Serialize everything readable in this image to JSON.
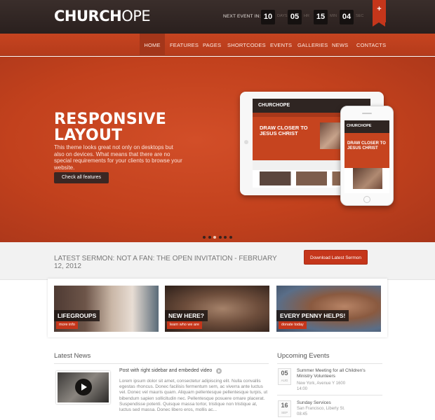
{
  "header": {
    "logo_bold": "CHURCH",
    "logo_light": "OPE",
    "next_event_label": "NEXT EVENT IN:",
    "countdown": [
      {
        "value": "10",
        "unit": "DAYS"
      },
      {
        "value": "05",
        "unit": "HR"
      },
      {
        "value": "15",
        "unit": "MIN"
      },
      {
        "value": "04",
        "unit": "SEC"
      }
    ],
    "ribbon_label": "+"
  },
  "nav": {
    "items": [
      "HOME",
      "FEATURES",
      "PAGES",
      "SHORTCODES",
      "EVENTS",
      "GALLERIES",
      "NEWS",
      "CONTACTS"
    ],
    "active": "HOME"
  },
  "hero": {
    "title_line1": "RESPONSIVE",
    "title_line2": "LAYOUT",
    "text": "This theme looks great not only on desktops but also on devices. What means that there are no special requirements  for your clients to browse your website.",
    "button": "Check all features",
    "mockup_logo": "CHURCHOPE",
    "mockup_heading_line1": "DRAW CLOSER TO",
    "mockup_heading_line2": "JESUS CHRIST",
    "slide_count": 6,
    "active_slide": 3
  },
  "sermon": {
    "text": "LATEST SERMON: NOT A FAN: THE OPEN INVITATION - FEBRUARY 12, 2012",
    "button": "Download Latest Sermon"
  },
  "cards": [
    {
      "title": "LIFEGROUPS",
      "tag": "more info"
    },
    {
      "title": "NEW HERE?",
      "tag": "learn who we are"
    },
    {
      "title": "EVERY PENNY HELPS!",
      "tag": "donate today"
    }
  ],
  "news": {
    "heading": "Latest News",
    "post_title": "Post with right sidebar and embeded video",
    "post_body": "Lorem ipsum dolor sit amet, consectetur adipiscing elit. Nulla convallis egestas rhoncus. Donec facilisis fermentum sem, ac viverra ante luctus vel. Donec vel mauris quam. Aliquam pellentesque pellentesque turpis, ut bibendum sapien sollicitudin nec. Pellentesque posuere ornare placerat. Suspendisse potenti. Quisque massa tortor, tristique non tristique at, luctus sed massa. Donec libero eros, mollis ac..."
  },
  "events": {
    "heading": "Upcoming Events",
    "items": [
      {
        "day": "05",
        "month": "AUG",
        "title": "Summer Meeting for all Children's Ministry Volunteers",
        "location": "New York, Avenue Y 1600",
        "time": "14:00"
      },
      {
        "day": "16",
        "month": "SEP",
        "title": "Sunday Services",
        "location": "San Francisco, Liberty St.",
        "time": "08:45"
      }
    ]
  }
}
